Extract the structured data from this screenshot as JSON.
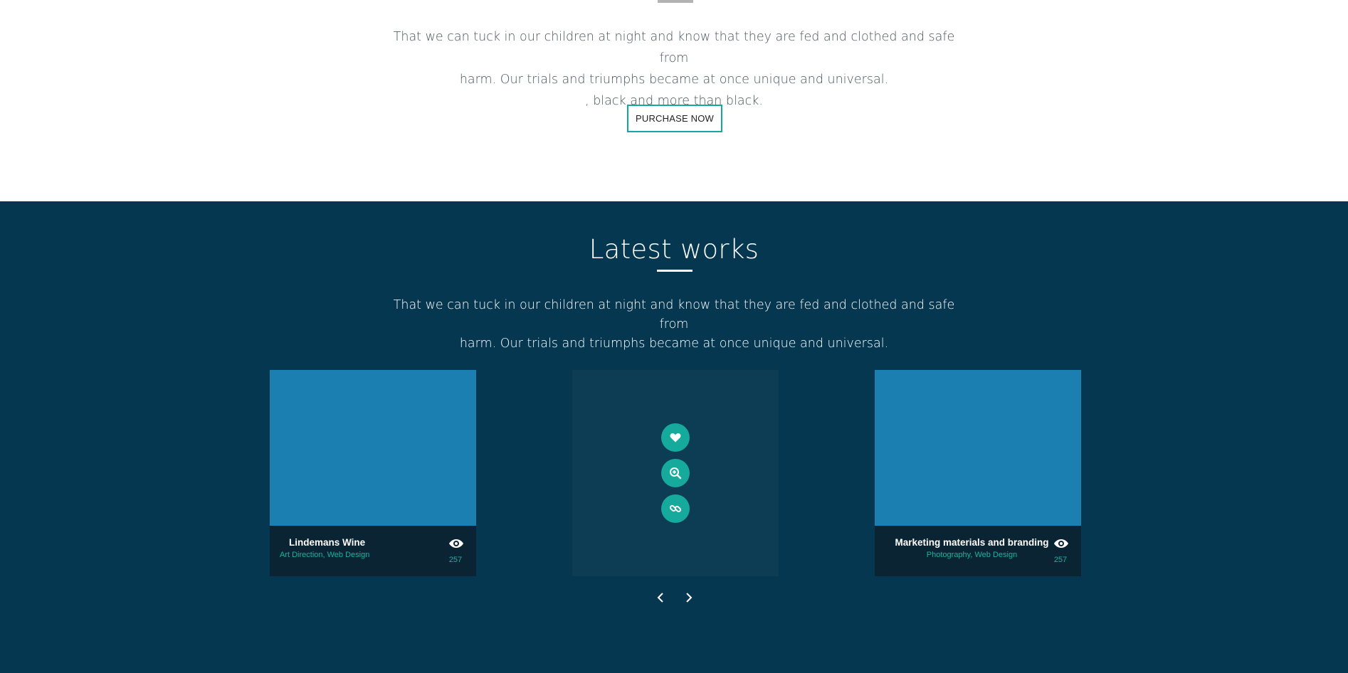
{
  "intro": {
    "lines": [
      "That we can tuck in our children at night and know that they are fed and clothed and safe from",
      "harm. Our trials and triumphs became at once unique and universal.",
      ", black and more than black."
    ],
    "purchase_label": "PURCHASE NOW"
  },
  "works": {
    "title": "Latest works",
    "lines": [
      "That we can tuck in our children at night and know that they are fed and clothed and safe from",
      "harm. Our trials and triumphs became at once unique and universal."
    ],
    "cards": [
      {
        "title": "Lindemans Wine",
        "categories": "Art Direction, Web Design",
        "views": "257"
      },
      {
        "title": "",
        "categories": "",
        "views": ""
      },
      {
        "title": "Marketing materials and branding",
        "categories": "Photography, Web Design",
        "views": "257"
      }
    ],
    "hover_actions": [
      "heart-icon",
      "zoom-in-icon",
      "link-icon"
    ]
  },
  "colors": {
    "accent": "#15aa9c",
    "section_bg": "#053750",
    "card_image": "#1b80b1",
    "caption_bg": "#0b2433"
  }
}
